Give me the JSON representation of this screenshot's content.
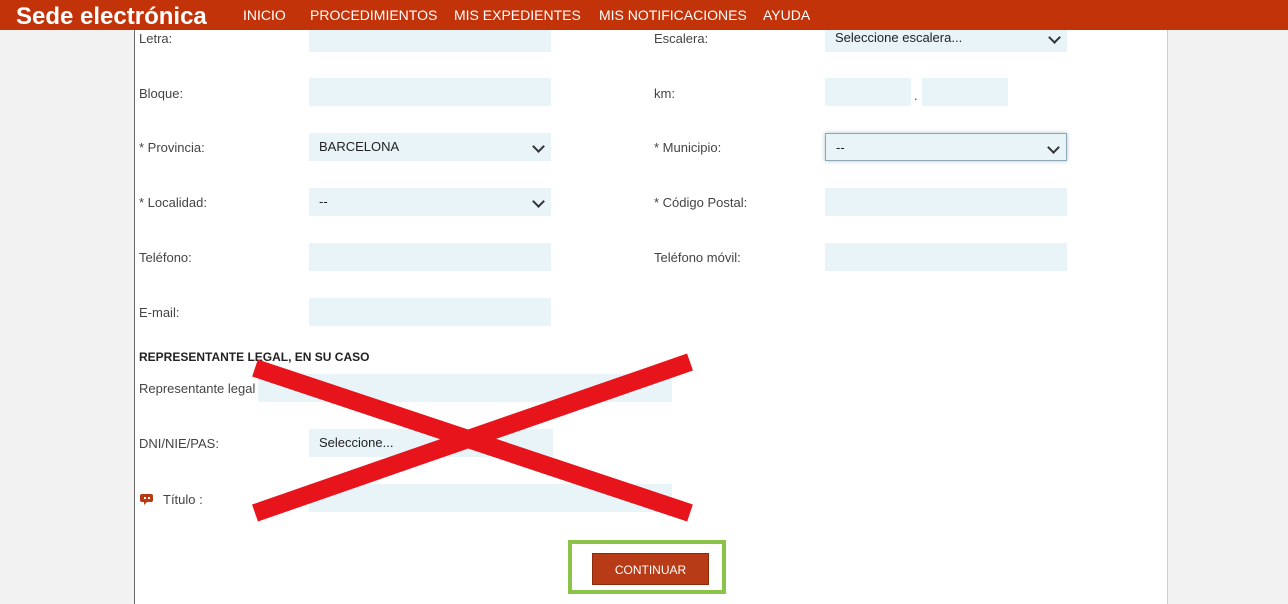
{
  "header": {
    "brand": "Sede electrónica",
    "nav": [
      "INICIO",
      "PROCEDIMIENTOS",
      "MIS EXPEDIENTES",
      "MIS NOTIFICACIONES",
      "AYUDA"
    ]
  },
  "form": {
    "letra_label": "Letra:",
    "escalera_label": "Escalera:",
    "escalera_value": "Seleccione escalera...",
    "bloque_label": "Bloque:",
    "km_label": "km:",
    "km_separator": ".",
    "provincia_label": "* Provincia:",
    "provincia_value": "BARCELONA",
    "municipio_label": "* Municipio:",
    "municipio_value": "--",
    "localidad_label": "* Localidad:",
    "localidad_value": "--",
    "codigo_postal_label": "* Código Postal:",
    "telefono_label": "Teléfono:",
    "telefono_movil_label": "Teléfono móvil:",
    "email_label": "E-mail:"
  },
  "representante": {
    "section_title": "REPRESENTANTE LEGAL, EN SU CASO",
    "representante_label": "Representante legal :",
    "dni_label": "DNI/NIE/PAS:",
    "dni_value": "Seleccione...",
    "titulo_label": "Título :"
  },
  "actions": {
    "continuar_label": "CONTINUAR"
  },
  "colors": {
    "header": "#c2330a",
    "field_bg": "#e8f4f8",
    "button": "#b73b16",
    "cross": "#e8141c",
    "highlight": "#8bc34a"
  }
}
